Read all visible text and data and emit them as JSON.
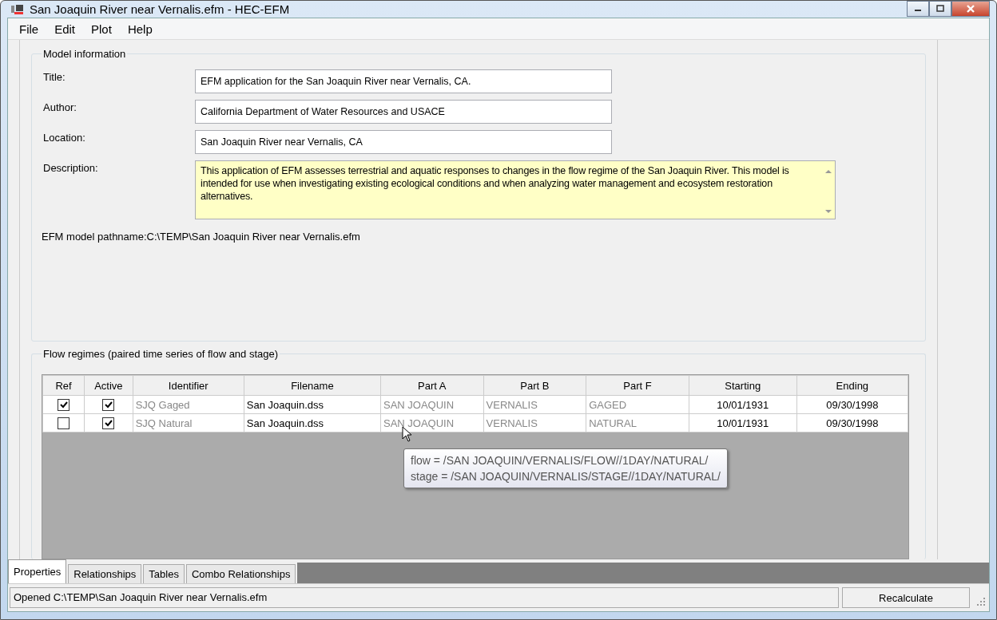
{
  "window": {
    "title": "San Joaquin River near Vernalis.efm - HEC-EFM"
  },
  "menu": [
    "File",
    "Edit",
    "Plot",
    "Help"
  ],
  "model_information": {
    "title": "Model information",
    "fields": [
      {
        "label": "Title:",
        "value": "EFM application for the San Joaquin River near Vernalis, CA."
      },
      {
        "label": "Author:",
        "value": "California Department of Water Resources and USACE"
      },
      {
        "label": "Location:",
        "value": "San Joaquin River near Vernalis, CA"
      }
    ],
    "description": {
      "label": "Description:",
      "value": "This application of EFM assesses terrestrial and aquatic responses to changes in the flow regime of the San Joaquin River.  This model is intended for use when investigating existing ecological conditions and when analyzing water management and ecosystem restoration alternatives."
    },
    "pathname": "EFM model pathname:C:\\TEMP\\San Joaquin River near Vernalis.efm"
  },
  "flow_regimes": {
    "title": "Flow regimes (paired time series of flow and stage)",
    "columns": [
      "Ref",
      "Active",
      "Identifier",
      "Filename",
      "Part A",
      "Part B",
      "Part F",
      "Starting",
      "Ending"
    ],
    "rows": [
      {
        "ref": true,
        "active": true,
        "identifier": "SJQ Gaged",
        "filename": "San Joaquin.dss",
        "part_a": "SAN JOAQUIN",
        "part_b": "VERNALIS",
        "part_f": "GAGED",
        "starting": "10/01/1931",
        "ending": "09/30/1998"
      },
      {
        "ref": false,
        "active": true,
        "identifier": "SJQ Natural",
        "filename": "San Joaquin.dss",
        "part_a": "SAN JOAQUIN",
        "part_b": "VERNALIS",
        "part_f": "NATURAL",
        "starting": "10/01/1931",
        "ending": "09/30/1998"
      }
    ],
    "tooltip": [
      "flow = /SAN JOAQUIN/VERNALIS/FLOW//1DAY/NATURAL/",
      "stage = /SAN JOAQUIN/VERNALIS/STAGE//1DAY/NATURAL/"
    ]
  },
  "tabs": [
    {
      "label": "Properties",
      "selected": true
    },
    {
      "label": "Relationships",
      "selected": false
    },
    {
      "label": "Tables",
      "selected": false
    },
    {
      "label": "Combo Relationships",
      "selected": false
    }
  ],
  "status_bar": {
    "message": "Opened C:\\TEMP\\San Joaquin River near Vernalis.efm",
    "button": "Recalculate"
  }
}
